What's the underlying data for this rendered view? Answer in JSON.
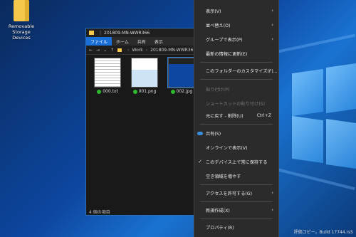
{
  "desktop": {
    "icon_label": "Removable Storage Devices",
    "watermark": "評価コピー。Build 17744.rs5"
  },
  "explorer": {
    "title": "201809-MN-WWR366",
    "ribbon_tabs": [
      "ファイル",
      "ホーム",
      "共有",
      "表示"
    ],
    "address": {
      "back": "←",
      "forward": "→",
      "dropdown": "⌄",
      "up": "↑",
      "crumbs": [
        "Work",
        "201809-MN-WWR366"
      ]
    },
    "files": [
      {
        "name": "000.txt"
      },
      {
        "name": "001.png"
      },
      {
        "name": "002.jpg"
      }
    ],
    "status": "4 個の項目"
  },
  "context_menu": {
    "items": [
      {
        "label": "表示(V)",
        "submenu": true,
        "disabled": false
      },
      {
        "label": "並べ替え(O)",
        "submenu": true,
        "disabled": false
      },
      {
        "label": "グループで表示(P)",
        "submenu": true,
        "disabled": false
      },
      {
        "label": "最新の情報に更新(E)",
        "submenu": false,
        "disabled": false
      },
      {
        "label": "このフォルダーのカスタマイズ(F)...",
        "submenu": false,
        "disabled": false
      },
      {
        "label": "貼り付け(P)",
        "submenu": false,
        "disabled": true
      },
      {
        "label": "ショートカットの貼り付け(S)",
        "submenu": false,
        "disabled": true
      },
      {
        "label": "元に戻す - 削除(U)",
        "shortcut": "Ctrl+Z",
        "submenu": false,
        "disabled": false
      },
      {
        "label": "共有(S)",
        "submenu": false,
        "disabled": false,
        "icon": "cloud-icon"
      },
      {
        "label": "オンラインで表示(V)",
        "submenu": false,
        "disabled": false
      },
      {
        "label": "このデバイス上で常に保持する",
        "submenu": false,
        "disabled": false,
        "icon": "check-icon"
      },
      {
        "label": "空き領域を増やす",
        "submenu": false,
        "disabled": false
      },
      {
        "label": "アクセスを許可する(G)",
        "submenu": true,
        "disabled": false
      },
      {
        "label": "新規作成(X)",
        "submenu": true,
        "disabled": false
      },
      {
        "label": "プロパティ(R)",
        "submenu": false,
        "disabled": false
      }
    ]
  }
}
